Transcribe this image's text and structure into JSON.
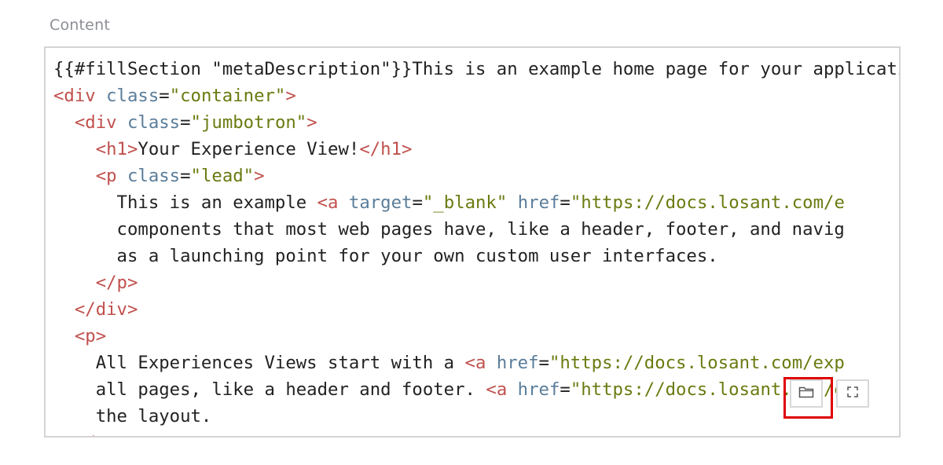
{
  "field": {
    "label": "Content"
  },
  "editor": {
    "lines": [
      [
        {
          "t": "pl",
          "v": "{{#fillSection \"metaDescription\"}}This is an example home page for your application.{{/fillSection}}"
        }
      ],
      [
        {
          "t": "tag",
          "v": "<div "
        },
        {
          "t": "attr",
          "v": "class"
        },
        {
          "t": "pl",
          "v": "="
        },
        {
          "t": "str",
          "v": "\"container\""
        },
        {
          "t": "tag",
          "v": ">"
        }
      ],
      [
        {
          "t": "pl",
          "v": "  "
        },
        {
          "t": "tag",
          "v": "<div "
        },
        {
          "t": "attr",
          "v": "class"
        },
        {
          "t": "pl",
          "v": "="
        },
        {
          "t": "str",
          "v": "\"jumbotron\""
        },
        {
          "t": "tag",
          "v": ">"
        }
      ],
      [
        {
          "t": "pl",
          "v": "    "
        },
        {
          "t": "tag",
          "v": "<h1>"
        },
        {
          "t": "pl",
          "v": "Your Experience View!"
        },
        {
          "t": "tag",
          "v": "</h1>"
        }
      ],
      [
        {
          "t": "pl",
          "v": "    "
        },
        {
          "t": "tag",
          "v": "<p "
        },
        {
          "t": "attr",
          "v": "class"
        },
        {
          "t": "pl",
          "v": "="
        },
        {
          "t": "str",
          "v": "\"lead\""
        },
        {
          "t": "tag",
          "v": ">"
        }
      ],
      [
        {
          "t": "pl",
          "v": "      This is an example "
        },
        {
          "t": "tag",
          "v": "<a "
        },
        {
          "t": "attr",
          "v": "target"
        },
        {
          "t": "pl",
          "v": "="
        },
        {
          "t": "str",
          "v": "\"_blank\""
        },
        {
          "t": "pl",
          "v": " "
        },
        {
          "t": "attr",
          "v": "href"
        },
        {
          "t": "pl",
          "v": "="
        },
        {
          "t": "str",
          "v": "\"https://docs.losant.com/e"
        }
      ],
      [
        {
          "t": "pl",
          "v": "      components that most web pages have, like a header, footer, and navig"
        }
      ],
      [
        {
          "t": "pl",
          "v": "      as a launching point for your own custom user interfaces."
        }
      ],
      [
        {
          "t": "pl",
          "v": "    "
        },
        {
          "t": "tag",
          "v": "</p>"
        }
      ],
      [
        {
          "t": "pl",
          "v": "  "
        },
        {
          "t": "tag",
          "v": "</div>"
        }
      ],
      [
        {
          "t": "pl",
          "v": "  "
        },
        {
          "t": "tag",
          "v": "<p>"
        }
      ],
      [
        {
          "t": "pl",
          "v": "    All Experiences Views start with a "
        },
        {
          "t": "tag",
          "v": "<a "
        },
        {
          "t": "attr",
          "v": "href"
        },
        {
          "t": "pl",
          "v": "="
        },
        {
          "t": "str",
          "v": "\"https://docs.losant.com/exp"
        }
      ],
      [
        {
          "t": "pl",
          "v": "    all pages, like a header and footer. "
        },
        {
          "t": "tag",
          "v": "<a "
        },
        {
          "t": "attr",
          "v": "href"
        },
        {
          "t": "pl",
          "v": "="
        },
        {
          "t": "str",
          "v": "\"https://docs.losant.com/e"
        }
      ],
      [
        {
          "t": "pl",
          "v": "    the layout."
        }
      ],
      [
        {
          "t": "pl",
          "v": "  "
        },
        {
          "t": "tag",
          "v": "</p>"
        }
      ]
    ]
  },
  "toolbar": {
    "browse_icon": "folder-icon",
    "fullscreen_icon": "expand-icon"
  },
  "colors": {
    "tag": "#c0504d",
    "attr": "#5a7d9a",
    "string": "#6b7a10",
    "highlight": "#e00000"
  }
}
